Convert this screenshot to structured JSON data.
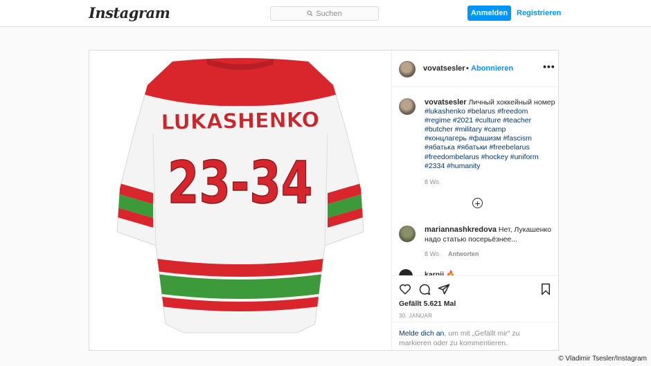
{
  "header": {
    "logo": "Instagram",
    "search_placeholder": "Suchen",
    "login_label": "Anmelden",
    "register_label": "Registrieren"
  },
  "post": {
    "image": {
      "name_on_jersey": "LUKASHENKO",
      "number_on_jersey": "23-34",
      "colors": {
        "red": "#d9262c",
        "green": "#3d9a3a",
        "white": "#f4f4f4"
      }
    },
    "author": "vovatsesler",
    "separator": "•",
    "follow_label": "Abonnieren",
    "more_label": "•••",
    "caption": {
      "username": "vovatsesler",
      "text": "Личный хоккейный номер",
      "hashtags_line1": "#lukashenko #belarus #freedom",
      "hashtags_line2": "#regime #2021 #culture #teacher",
      "hashtags_line3": "#butcher #military #camp",
      "hashtags_line4": "#концлагерь #фашизм #fascism",
      "hashtags_line5": "#ябатька #ябатьки #freebelarus",
      "hashtags_line6": "#freedombelarus #hockey #uniform",
      "hashtags_line7": "#2334 #humanity",
      "age": "8 Wo."
    },
    "load_more_icon": "plus-circle-icon",
    "comment": {
      "username": "mariannashkredova",
      "text": "Нет, Лукашенко надо статью посерьёзнее...",
      "age": "8 Wo.",
      "reply_label": "Antworten"
    },
    "partial_comment": {
      "username": "karnii",
      "emoji": "🔥"
    },
    "actions": {
      "like_icon": "heart-icon",
      "comment_icon": "comment-icon",
      "share_icon": "share-icon",
      "save_icon": "bookmark-icon"
    },
    "likes": "Gefällt 5.621 Mal",
    "date": "30. JANUAR",
    "login_prompt": {
      "link": "Melde dich an",
      "rest": ", um mit „Gefällt mir“ zu markieren oder zu kommentieren."
    }
  },
  "credit": "© Vladimir Tsesler/Instagram"
}
